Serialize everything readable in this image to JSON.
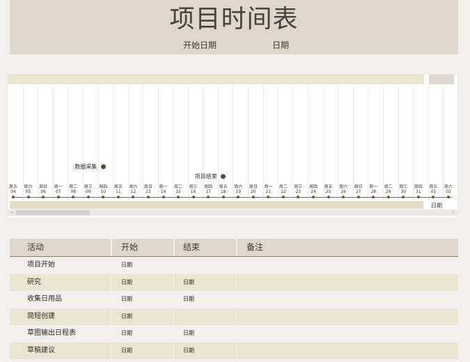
{
  "header": {
    "title": "项目时间表",
    "start_date_label": "开始日期",
    "start_date_value": "日期"
  },
  "timeline": {
    "days": [
      {
        "weekday": "周五",
        "date": "04"
      },
      {
        "weekday": "周六",
        "date": "05"
      },
      {
        "weekday": "周日",
        "date": "06"
      },
      {
        "weekday": "周一",
        "date": "07"
      },
      {
        "weekday": "周二",
        "date": "08"
      },
      {
        "weekday": "周三",
        "date": "09"
      },
      {
        "weekday": "周四",
        "date": "10"
      },
      {
        "weekday": "周五",
        "date": "11"
      },
      {
        "weekday": "周六",
        "date": "12"
      },
      {
        "weekday": "周日",
        "date": "13"
      },
      {
        "weekday": "周一",
        "date": "14"
      },
      {
        "weekday": "周二",
        "date": "15"
      },
      {
        "weekday": "周三",
        "date": "16"
      },
      {
        "weekday": "周四",
        "date": "17"
      },
      {
        "weekday": "周五",
        "date": "18"
      },
      {
        "weekday": "周六",
        "date": "19"
      },
      {
        "weekday": "周日",
        "date": "20"
      },
      {
        "weekday": "周一",
        "date": "21"
      },
      {
        "weekday": "周二",
        "date": "22"
      },
      {
        "weekday": "周三",
        "date": "23"
      },
      {
        "weekday": "周四",
        "date": "24"
      },
      {
        "weekday": "周五",
        "date": "25"
      },
      {
        "weekday": "周六",
        "date": "26"
      },
      {
        "weekday": "周日",
        "date": "27"
      },
      {
        "weekday": "周一",
        "date": "28"
      },
      {
        "weekday": "周二",
        "date": "29"
      },
      {
        "weekday": "周三",
        "date": "30"
      },
      {
        "weekday": "周四",
        "date": "31"
      },
      {
        "weekday": "周五",
        "date": "01"
      },
      {
        "weekday": "周六",
        "date": "02"
      }
    ],
    "milestones": [
      {
        "label": "数据采集",
        "day_index": 6
      },
      {
        "label": "项目结束",
        "day_index": 14
      }
    ],
    "bottom_label": "日期"
  },
  "table": {
    "headers": {
      "activity": "活动",
      "start": "开始",
      "end": "结束",
      "notes": "备注"
    },
    "rows": [
      {
        "activity": "项目开始",
        "start": "日期",
        "end": "",
        "notes": ""
      },
      {
        "activity": "研究",
        "start": "日期",
        "end": "日期",
        "notes": ""
      },
      {
        "activity": "收集日用品",
        "start": "日期",
        "end": "日期",
        "notes": ""
      },
      {
        "activity": "简短创建",
        "start": "日期",
        "end": "",
        "notes": ""
      },
      {
        "activity": "草图输出日程表",
        "start": "日期",
        "end": "日期",
        "notes": ""
      },
      {
        "activity": "草稿建议",
        "start": "日期",
        "end": "日期",
        "notes": ""
      }
    ]
  }
}
